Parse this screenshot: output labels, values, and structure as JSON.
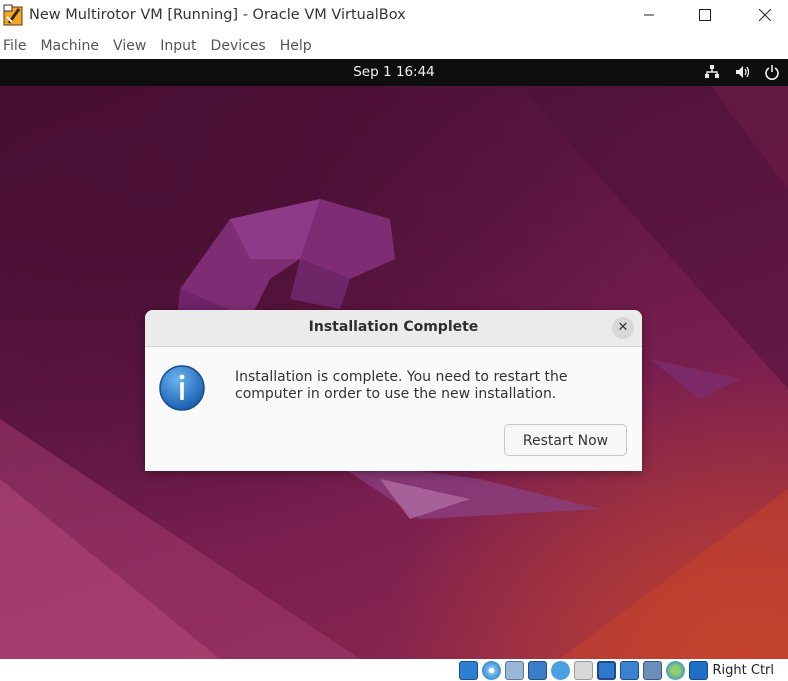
{
  "window": {
    "title": "New Multirotor VM [Running] - Oracle VM VirtualBox",
    "controls": {
      "minimize": "—",
      "maximize": "☐",
      "close": "✕"
    }
  },
  "menu": {
    "items": [
      {
        "label": "File"
      },
      {
        "label": "Machine"
      },
      {
        "label": "View"
      },
      {
        "label": "Input"
      },
      {
        "label": "Devices"
      },
      {
        "label": "Help"
      }
    ]
  },
  "guest": {
    "topbar": {
      "clock": "Sep 1  16:44",
      "tray_icons": [
        "network-icon",
        "volume-icon",
        "power-icon"
      ]
    },
    "dialog": {
      "title": "Installation Complete",
      "close_glyph": "✕",
      "icon": "info-icon",
      "message": "Installation is complete. You need to restart the computer in order to use the new installation.",
      "button_label": "Restart Now"
    },
    "wallpaper": {
      "accent": "#7a1f4f",
      "corner": "#c4432b"
    }
  },
  "statusbar": {
    "icons": [
      "hard-disk-icon",
      "optical-drive-icon",
      "audio-icon",
      "network-icon",
      "usb-icon",
      "shared-folders-icon",
      "display-icon",
      "video-capture-icon",
      "cpu-icon",
      "mouse-integration-icon",
      "keyboard-capture-icon"
    ],
    "host_key": "Right Ctrl"
  }
}
